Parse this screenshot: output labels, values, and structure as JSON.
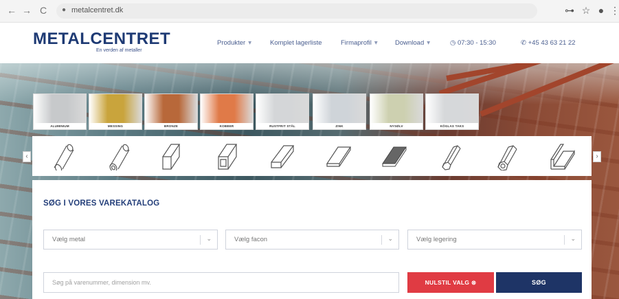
{
  "browser": {
    "url": "metalcentret.dk",
    "back_icon": "←",
    "forward_icon": "→",
    "reload_icon": "C",
    "key_icon": "⊶",
    "star_icon": "☆",
    "account_icon": "●",
    "menu_icon": "⋮"
  },
  "header": {
    "logo": "METALCENTRET",
    "tagline": "En verden af metaller",
    "nav": [
      {
        "label": "Produkter",
        "caret": "▾"
      },
      {
        "label": "Komplet lagerliste",
        "caret": ""
      },
      {
        "label": "Firmaprofil",
        "caret": "▾"
      },
      {
        "label": "Download",
        "caret": "▾"
      }
    ],
    "hours_icon": "◷",
    "hours": "07:30 - 15:30",
    "phone_icon": "✆",
    "phone": "+45 43 63 21 22"
  },
  "metals": [
    {
      "label": "ALUMINIUM",
      "color": "#c7c9cb"
    },
    {
      "label": "MESSING",
      "color": "#c9a43c"
    },
    {
      "label": "BRONZE",
      "color": "#b8683a"
    },
    {
      "label": "KOBBER",
      "color": "#e07a48"
    },
    {
      "label": "RUSTFRIT STÅL",
      "color": "#d4d6d8"
    },
    {
      "label": "ZINK",
      "color": "#cfd4d9"
    },
    {
      "label": "NYSØLV",
      "color": "#cdd0b0"
    },
    {
      "label": "KÖGLAS TAKS",
      "color": "#d6d8da"
    }
  ],
  "shapes": {
    "icons": [
      "round-bar-icon",
      "round-tube-icon",
      "square-bar-icon",
      "square-tube-icon",
      "flat-bar-icon",
      "sheet-plate-icon",
      "mesh-plate-icon",
      "hex-bar-icon",
      "hex-tube-icon",
      "angle-profile-icon"
    ],
    "prev_arrow": "‹",
    "next_arrow": "›"
  },
  "search": {
    "title": "SØG I VORES VAREKATALOG",
    "select_metal": "Vælg metal",
    "select_shape": "Vælg facon",
    "select_alloy": "Vælg legering",
    "chevron": "⌄",
    "query_placeholder": "Søg på varenummer, dimension mv.",
    "reset_label": "NULSTIL VALG ⊗",
    "search_label": "SØG"
  }
}
